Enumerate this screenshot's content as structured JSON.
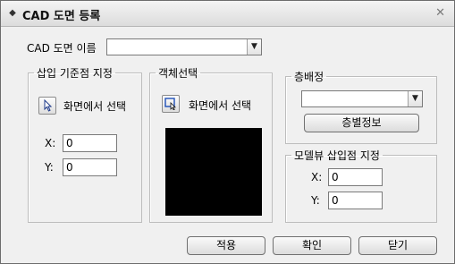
{
  "titlebar": {
    "title": "CAD 도면 등록",
    "icon": "chevron-icon",
    "close_glyph": "✕"
  },
  "cad_name": {
    "label": "CAD 도면 이름",
    "value": ""
  },
  "insert_point": {
    "legend": "삽입 기준점 지정",
    "pick_label": "화면에서 선택",
    "x_label": "X:",
    "x_value": "0",
    "y_label": "Y:",
    "y_value": "0"
  },
  "object_select": {
    "legend": "객체선택",
    "pick_label": "화면에서 선택"
  },
  "layer": {
    "legend": "층배정",
    "value": "",
    "info_button": "층별정보"
  },
  "model_insert": {
    "legend": "모델뷰 삽입점 지정",
    "x_label": "X:",
    "x_value": "0",
    "y_label": "Y:",
    "y_value": "0"
  },
  "buttons": {
    "apply": "적용",
    "ok": "확인",
    "close": "닫기"
  }
}
